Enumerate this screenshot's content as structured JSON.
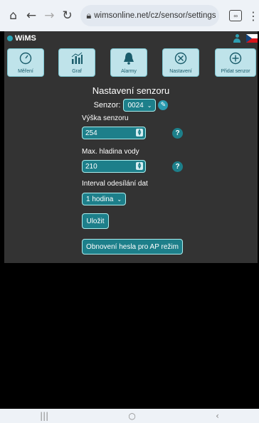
{
  "browser": {
    "url": "wimsonline.net/cz/sensor/settings",
    "home_icon": "home-icon",
    "tabs_label": "∞"
  },
  "app": {
    "brand": "WiMS",
    "nav": [
      {
        "label": "Měření",
        "icon": "gauge-icon"
      },
      {
        "label": "Graf",
        "icon": "bar-chart-icon"
      },
      {
        "label": "Alarmy",
        "icon": "bell-icon"
      },
      {
        "label": "Nastavení",
        "icon": "settings-icon"
      },
      {
        "label": "Přidat senzor",
        "icon": "add-icon"
      }
    ],
    "colors": {
      "accent": "#1d7f8a",
      "panel": "#333333",
      "nav_bg": "#bfe3ea"
    }
  },
  "form": {
    "title": "Nastavení senzoru",
    "sensor_label": "Senzor:",
    "sensor_value": "0024",
    "height_label": "Výška senzoru",
    "height_value": "254",
    "max_level_label": "Max. hladina vody",
    "max_level_value": "210",
    "interval_label": "Interval odesílání dat",
    "interval_value": "1 hodina",
    "help": "?",
    "save_label": "Uložit",
    "reset_ap_label": "Obnovení hesla pro AP režim"
  }
}
